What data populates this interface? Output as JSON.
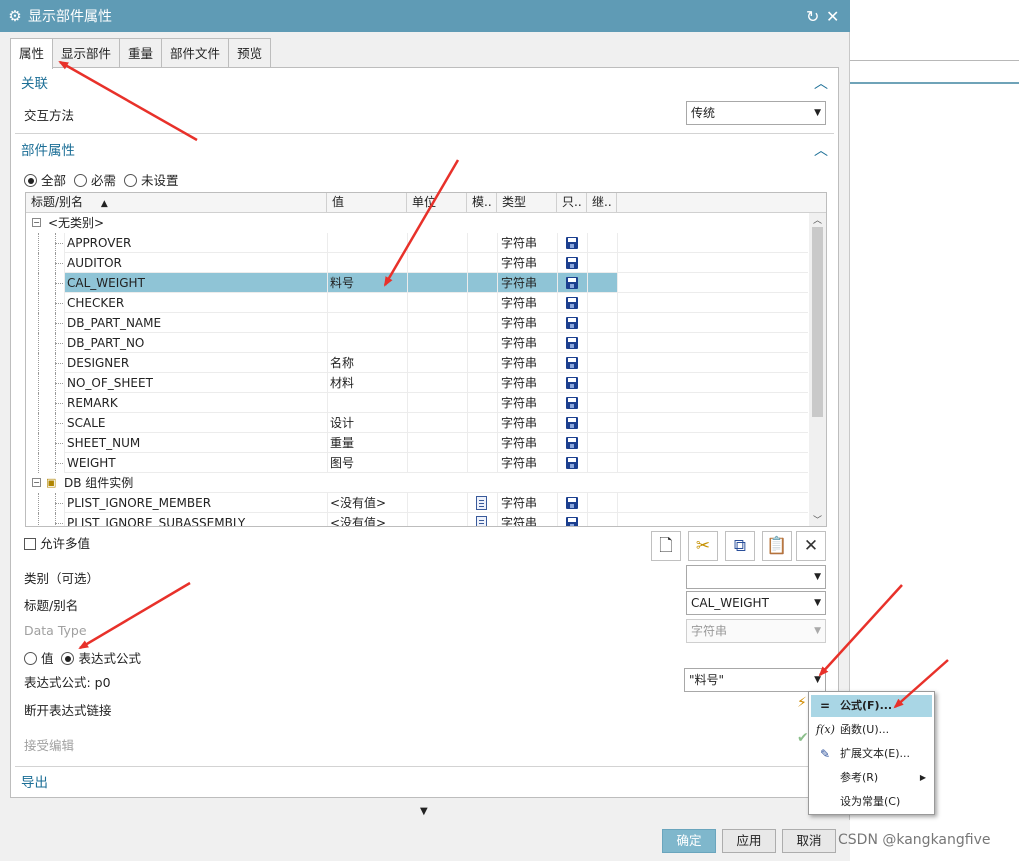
{
  "window": {
    "title": "显示部件属性"
  },
  "tabs": [
    "属性",
    "显示部件",
    "重量",
    "部件文件",
    "预览"
  ],
  "association": {
    "header": "关联",
    "method_label": "交互方法",
    "method_value": "传统"
  },
  "part_attributes": {
    "header": "部件属性",
    "filter_options": [
      "全部",
      "必需",
      "未设置"
    ],
    "selected_filter": "全部",
    "columns": [
      "标题/别名",
      "值",
      "单位",
      "模..",
      "类型",
      "只..",
      "继.."
    ],
    "groups": [
      {
        "name": "<无类别>"
      },
      {
        "name": "DB 组件实例"
      }
    ],
    "rows": [
      {
        "title": "APPROVER",
        "value": "",
        "type": "字符串"
      },
      {
        "title": "AUDITOR",
        "value": "",
        "type": "字符串"
      },
      {
        "title": "CAL_WEIGHT",
        "value": "料号",
        "type": "字符串"
      },
      {
        "title": "CHECKER",
        "value": "",
        "type": "字符串"
      },
      {
        "title": "DB_PART_NAME",
        "value": "",
        "type": "字符串"
      },
      {
        "title": "DB_PART_NO",
        "value": "",
        "type": "字符串"
      },
      {
        "title": "DESIGNER",
        "value": "名称",
        "type": "字符串"
      },
      {
        "title": "NO_OF_SHEET",
        "value": "材料",
        "type": "字符串"
      },
      {
        "title": "REMARK",
        "value": "",
        "type": "字符串"
      },
      {
        "title": "SCALE",
        "value": "设计",
        "type": "字符串"
      },
      {
        "title": "SHEET_NUM",
        "value": "重量",
        "type": "字符串"
      },
      {
        "title": "WEIGHT",
        "value": "图号",
        "type": "字符串"
      }
    ],
    "db_rows": [
      {
        "title": "PLIST_IGNORE_MEMBER",
        "value": "<没有值>",
        "type": "字符串"
      },
      {
        "title": "PLIST_IGNORE_SUBASSEMBLY",
        "value": "<没有值>",
        "type": "字符串"
      }
    ],
    "allow_multiple_label": "允许多值",
    "category_label": "类别（可选）",
    "category_value": "",
    "title_alias_label": "标题/别名",
    "title_alias_value": "CAL_WEIGHT",
    "data_type_label": "Data Type",
    "data_type_value": "字符串",
    "value_radio": "值",
    "expression_radio": "表达式公式",
    "expression_label": "表达式公式: p0",
    "expression_value": "\"料号\"",
    "break_link_label": "断开表达式链接",
    "accept_edit_label": "接受编辑"
  },
  "export": {
    "header": "导出"
  },
  "buttons": {
    "ok": "确定",
    "apply": "应用",
    "cancel": "取消"
  },
  "context_menu": {
    "items": [
      {
        "label": "公式(F)...",
        "icon": "equals-icon"
      },
      {
        "label": "函数(U)...",
        "icon": "function-icon"
      },
      {
        "label": "扩展文本(E)...",
        "icon": "edit-text-icon"
      },
      {
        "label": "参考(R)",
        "icon": "none"
      },
      {
        "label": "设为常量(C)",
        "icon": "none"
      }
    ]
  },
  "watermark": "CSDN @kangkangfive",
  "colors": {
    "titlebar": "#5f9bb5",
    "section_header": "#1b6e96",
    "selection": "#8fc4d6",
    "menu_highlight": "#a9d6e5",
    "annotation_arrow": "#e8312a"
  }
}
